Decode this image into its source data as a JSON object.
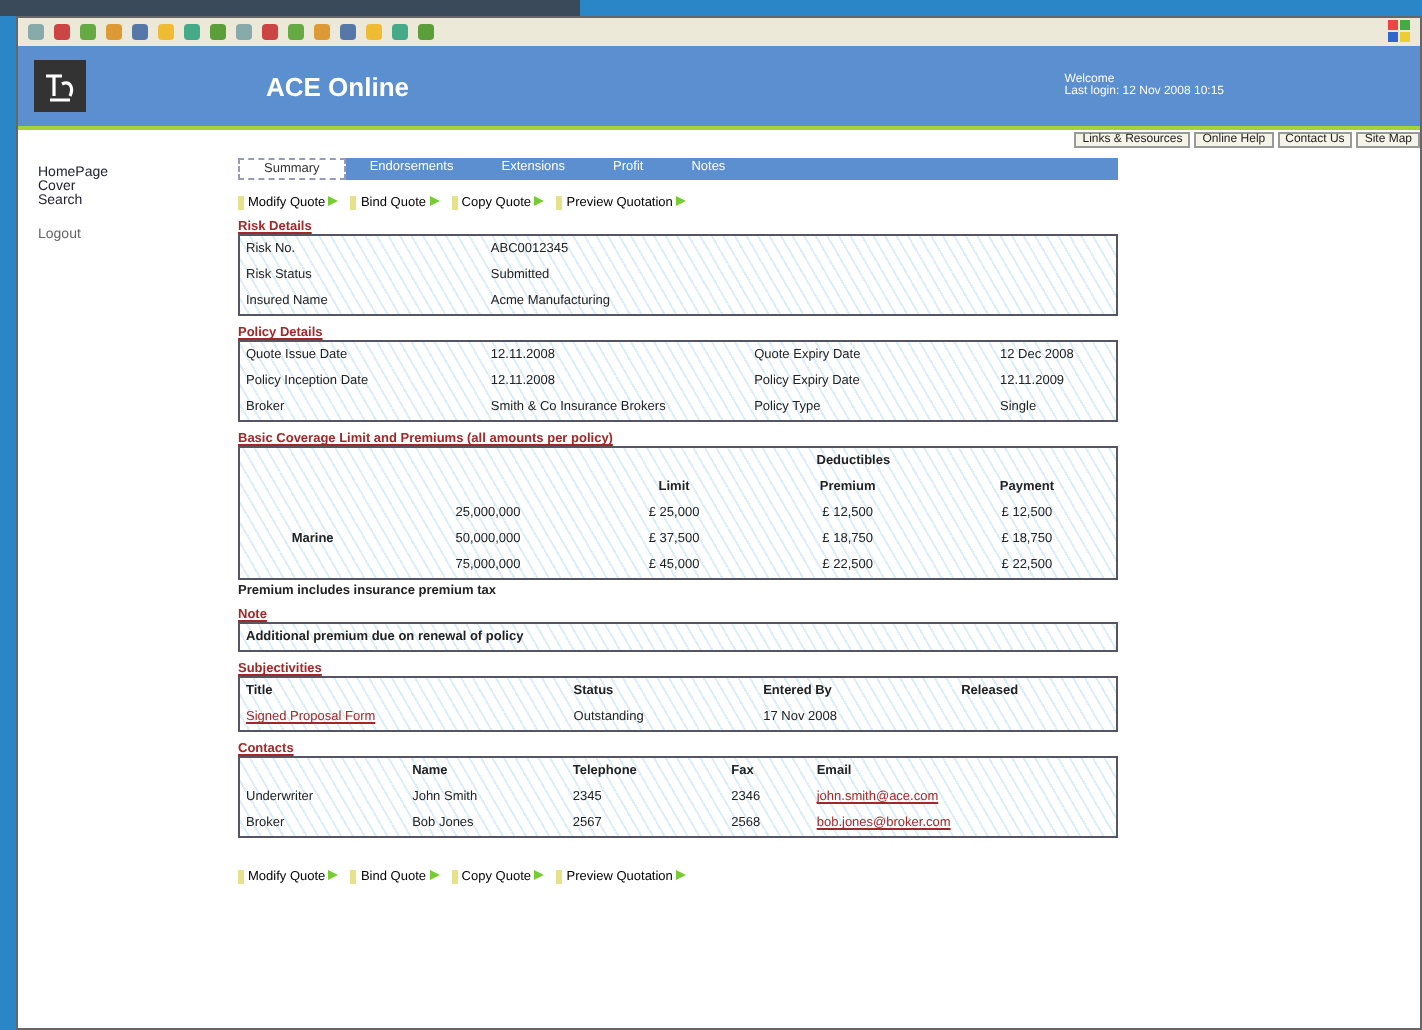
{
  "header": {
    "title": "ACE Online",
    "user_lines": [
      "Welcome",
      "Last login: 12 Nov 2008 10:15"
    ]
  },
  "top_links": [
    "Links & Resources",
    "Online Help",
    "Contact Us",
    "Site Map"
  ],
  "sidebar": {
    "items": [
      "HomePage",
      "Cover",
      "Search"
    ],
    "logout": "Logout"
  },
  "tabs": [
    {
      "label": "Summary",
      "selected": true
    },
    {
      "label": "Endorsements",
      "selected": false
    },
    {
      "label": "Extensions",
      "selected": false
    },
    {
      "label": "Profit",
      "selected": false
    },
    {
      "label": "Notes",
      "selected": false
    }
  ],
  "actions": [
    "Modify Quote",
    "Bind Quote",
    "Copy Quote",
    "Preview Quotation"
  ],
  "risk_details": {
    "title": "Risk Details",
    "rows": [
      [
        "Risk No.",
        "ABC0012345"
      ],
      [
        "Risk Status",
        "Submitted"
      ],
      [
        "Insured Name",
        "Acme Manufacturing"
      ]
    ]
  },
  "policy_details": {
    "title": "Policy Details",
    "rows": [
      [
        "Quote Issue Date",
        "12.11.2008",
        "Quote Expiry Date",
        "12 Dec 2008"
      ],
      [
        "Policy Inception Date",
        "12.11.2008",
        "Policy Expiry Date",
        "12.11.2009"
      ],
      [
        "Broker",
        "Smith & Co Insurance Brokers",
        "Policy Type",
        "Single"
      ]
    ]
  },
  "coverage": {
    "title": "Basic Coverage Limit and Premiums (all amounts per policy)",
    "group_header": "Deductibles",
    "columns": [
      "",
      "",
      "Limit",
      "Premium",
      "Payment"
    ],
    "rows": [
      [
        "",
        "25,000,000",
        "£ 25,000",
        "£ 12,500",
        "£ 12,500"
      ],
      [
        "Marine",
        "50,000,000",
        "£ 37,500",
        "£ 18,750",
        "£ 18,750"
      ],
      [
        "",
        "75,000,000",
        "£ 45,000",
        "£ 22,500",
        "£ 22,500"
      ]
    ],
    "note": "Premium includes insurance premium tax"
  },
  "notes": {
    "title": "Note",
    "text": "Additional premium due on renewal of policy"
  },
  "subjectivities": {
    "title": "Subjectivities",
    "columns": [
      "Title",
      "Status",
      "Entered By",
      "Released"
    ],
    "rows": [
      [
        "Signed Proposal Form",
        "Outstanding",
        "17 Nov 2008",
        ""
      ]
    ]
  },
  "contacts": {
    "title": "Contacts",
    "columns": [
      "",
      "Name",
      "Telephone",
      "Fax",
      "Email"
    ],
    "rows": [
      [
        "Underwriter",
        "John Smith",
        "2345",
        "2346",
        "john.smith@ace.com"
      ],
      [
        "Broker",
        "Bob Jones",
        "2567",
        "2568",
        "bob.jones@broker.com"
      ]
    ]
  },
  "bottom_actions": [
    "Modify Quote",
    "Bind Quote",
    "Copy Quote",
    "Preview Quotation"
  ]
}
